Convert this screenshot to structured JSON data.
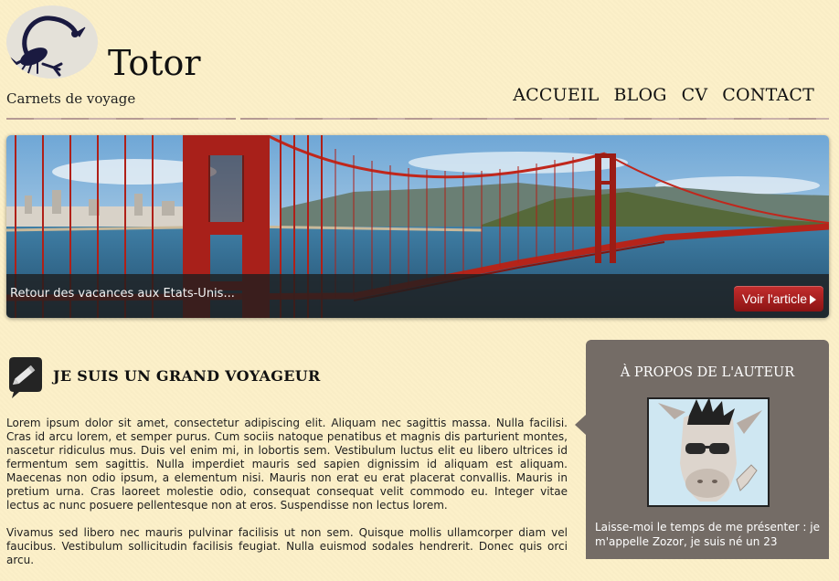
{
  "header": {
    "title": "Totor",
    "subtitle": "Carnets de voyage"
  },
  "nav": {
    "items": [
      "ACCUEIL",
      "BLOG",
      "CV",
      "CONTACT"
    ]
  },
  "banner": {
    "caption": "Retour des vacances aux Etats-Unis...",
    "button_label": "Voir l'article"
  },
  "article": {
    "title": "JE SUIS UN GRAND VOYAGEUR",
    "paragraphs": [
      "Lorem ipsum dolor sit amet, consectetur adipiscing elit. Aliquam nec sagittis massa. Nulla facilisi. Cras id arcu lorem, et semper purus. Cum sociis natoque penatibus et magnis dis parturient montes, nascetur ridiculus mus. Duis vel enim mi, in lobortis sem. Vestibulum luctus elit eu libero ultrices id fermentum sem sagittis. Nulla imperdiet mauris sed sapien dignissim id aliquam est aliquam. Maecenas non odio ipsum, a elementum nisi. Mauris non erat eu erat placerat convallis. Mauris in pretium urna. Cras laoreet molestie odio, consequat consequat velit commodo eu. Integer vitae lectus ac nunc posuere pellentesque non at eros. Suspendisse non lectus lorem.",
      "Vivamus sed libero nec mauris pulvinar facilisis ut non sem. Quisque mollis ullamcorper diam vel faucibus. Vestibulum sollicitudin facilisis feugiat. Nulla euismod sodales hendrerit. Donec quis orci arcu."
    ]
  },
  "sidebar": {
    "title": "À PROPOS DE L'AUTEUR",
    "text": "Laisse-moi le temps de me présenter : je m'appelle Zozor, je suis né un 23"
  },
  "icons": {
    "logo": "scorpion-logo-icon",
    "article": "pencil-icon"
  },
  "colors": {
    "background": "#fcf0c8",
    "sidebar": "#746c66",
    "button": "#a01c1c"
  }
}
